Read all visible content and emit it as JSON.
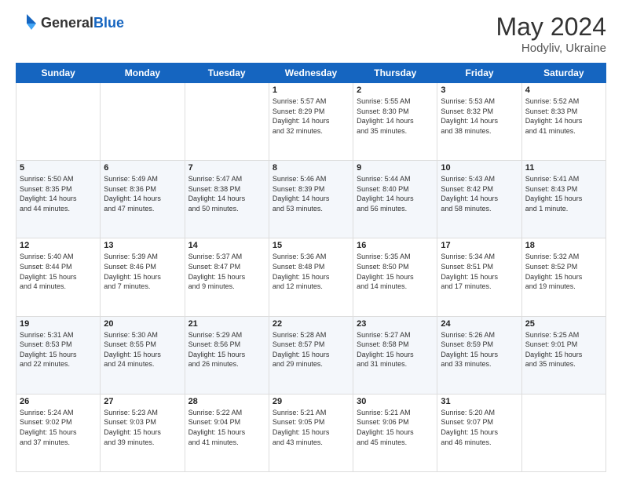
{
  "header": {
    "logo_general": "General",
    "logo_blue": "Blue",
    "month": "May 2024",
    "location": "Hodyliv, Ukraine"
  },
  "weekdays": [
    "Sunday",
    "Monday",
    "Tuesday",
    "Wednesday",
    "Thursday",
    "Friday",
    "Saturday"
  ],
  "weeks": [
    [
      {
        "day": "",
        "info": ""
      },
      {
        "day": "",
        "info": ""
      },
      {
        "day": "",
        "info": ""
      },
      {
        "day": "1",
        "info": "Sunrise: 5:57 AM\nSunset: 8:29 PM\nDaylight: 14 hours\nand 32 minutes."
      },
      {
        "day": "2",
        "info": "Sunrise: 5:55 AM\nSunset: 8:30 PM\nDaylight: 14 hours\nand 35 minutes."
      },
      {
        "day": "3",
        "info": "Sunrise: 5:53 AM\nSunset: 8:32 PM\nDaylight: 14 hours\nand 38 minutes."
      },
      {
        "day": "4",
        "info": "Sunrise: 5:52 AM\nSunset: 8:33 PM\nDaylight: 14 hours\nand 41 minutes."
      }
    ],
    [
      {
        "day": "5",
        "info": "Sunrise: 5:50 AM\nSunset: 8:35 PM\nDaylight: 14 hours\nand 44 minutes."
      },
      {
        "day": "6",
        "info": "Sunrise: 5:49 AM\nSunset: 8:36 PM\nDaylight: 14 hours\nand 47 minutes."
      },
      {
        "day": "7",
        "info": "Sunrise: 5:47 AM\nSunset: 8:38 PM\nDaylight: 14 hours\nand 50 minutes."
      },
      {
        "day": "8",
        "info": "Sunrise: 5:46 AM\nSunset: 8:39 PM\nDaylight: 14 hours\nand 53 minutes."
      },
      {
        "day": "9",
        "info": "Sunrise: 5:44 AM\nSunset: 8:40 PM\nDaylight: 14 hours\nand 56 minutes."
      },
      {
        "day": "10",
        "info": "Sunrise: 5:43 AM\nSunset: 8:42 PM\nDaylight: 14 hours\nand 58 minutes."
      },
      {
        "day": "11",
        "info": "Sunrise: 5:41 AM\nSunset: 8:43 PM\nDaylight: 15 hours\nand 1 minute."
      }
    ],
    [
      {
        "day": "12",
        "info": "Sunrise: 5:40 AM\nSunset: 8:44 PM\nDaylight: 15 hours\nand 4 minutes."
      },
      {
        "day": "13",
        "info": "Sunrise: 5:39 AM\nSunset: 8:46 PM\nDaylight: 15 hours\nand 7 minutes."
      },
      {
        "day": "14",
        "info": "Sunrise: 5:37 AM\nSunset: 8:47 PM\nDaylight: 15 hours\nand 9 minutes."
      },
      {
        "day": "15",
        "info": "Sunrise: 5:36 AM\nSunset: 8:48 PM\nDaylight: 15 hours\nand 12 minutes."
      },
      {
        "day": "16",
        "info": "Sunrise: 5:35 AM\nSunset: 8:50 PM\nDaylight: 15 hours\nand 14 minutes."
      },
      {
        "day": "17",
        "info": "Sunrise: 5:34 AM\nSunset: 8:51 PM\nDaylight: 15 hours\nand 17 minutes."
      },
      {
        "day": "18",
        "info": "Sunrise: 5:32 AM\nSunset: 8:52 PM\nDaylight: 15 hours\nand 19 minutes."
      }
    ],
    [
      {
        "day": "19",
        "info": "Sunrise: 5:31 AM\nSunset: 8:53 PM\nDaylight: 15 hours\nand 22 minutes."
      },
      {
        "day": "20",
        "info": "Sunrise: 5:30 AM\nSunset: 8:55 PM\nDaylight: 15 hours\nand 24 minutes."
      },
      {
        "day": "21",
        "info": "Sunrise: 5:29 AM\nSunset: 8:56 PM\nDaylight: 15 hours\nand 26 minutes."
      },
      {
        "day": "22",
        "info": "Sunrise: 5:28 AM\nSunset: 8:57 PM\nDaylight: 15 hours\nand 29 minutes."
      },
      {
        "day": "23",
        "info": "Sunrise: 5:27 AM\nSunset: 8:58 PM\nDaylight: 15 hours\nand 31 minutes."
      },
      {
        "day": "24",
        "info": "Sunrise: 5:26 AM\nSunset: 8:59 PM\nDaylight: 15 hours\nand 33 minutes."
      },
      {
        "day": "25",
        "info": "Sunrise: 5:25 AM\nSunset: 9:01 PM\nDaylight: 15 hours\nand 35 minutes."
      }
    ],
    [
      {
        "day": "26",
        "info": "Sunrise: 5:24 AM\nSunset: 9:02 PM\nDaylight: 15 hours\nand 37 minutes."
      },
      {
        "day": "27",
        "info": "Sunrise: 5:23 AM\nSunset: 9:03 PM\nDaylight: 15 hours\nand 39 minutes."
      },
      {
        "day": "28",
        "info": "Sunrise: 5:22 AM\nSunset: 9:04 PM\nDaylight: 15 hours\nand 41 minutes."
      },
      {
        "day": "29",
        "info": "Sunrise: 5:21 AM\nSunset: 9:05 PM\nDaylight: 15 hours\nand 43 minutes."
      },
      {
        "day": "30",
        "info": "Sunrise: 5:21 AM\nSunset: 9:06 PM\nDaylight: 15 hours\nand 45 minutes."
      },
      {
        "day": "31",
        "info": "Sunrise: 5:20 AM\nSunset: 9:07 PM\nDaylight: 15 hours\nand 46 minutes."
      },
      {
        "day": "",
        "info": ""
      }
    ]
  ]
}
